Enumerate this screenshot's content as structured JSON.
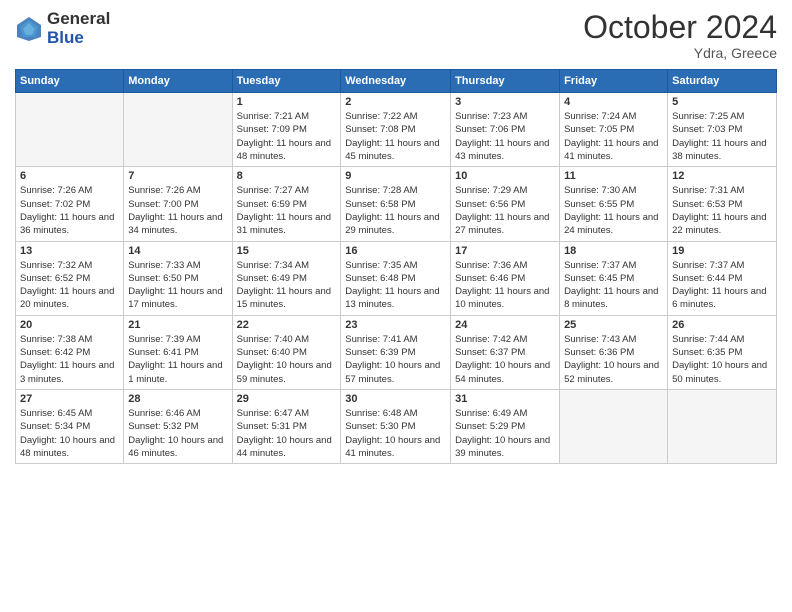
{
  "header": {
    "logo": {
      "general": "General",
      "blue": "Blue"
    },
    "title": "October 2024",
    "subtitle": "Ydra, Greece"
  },
  "weekdays": [
    "Sunday",
    "Monday",
    "Tuesday",
    "Wednesday",
    "Thursday",
    "Friday",
    "Saturday"
  ],
  "weeks": [
    [
      {
        "day": "",
        "info": ""
      },
      {
        "day": "",
        "info": ""
      },
      {
        "day": "1",
        "info": "Sunrise: 7:21 AM\nSunset: 7:09 PM\nDaylight: 11 hours and 48 minutes."
      },
      {
        "day": "2",
        "info": "Sunrise: 7:22 AM\nSunset: 7:08 PM\nDaylight: 11 hours and 45 minutes."
      },
      {
        "day": "3",
        "info": "Sunrise: 7:23 AM\nSunset: 7:06 PM\nDaylight: 11 hours and 43 minutes."
      },
      {
        "day": "4",
        "info": "Sunrise: 7:24 AM\nSunset: 7:05 PM\nDaylight: 11 hours and 41 minutes."
      },
      {
        "day": "5",
        "info": "Sunrise: 7:25 AM\nSunset: 7:03 PM\nDaylight: 11 hours and 38 minutes."
      }
    ],
    [
      {
        "day": "6",
        "info": "Sunrise: 7:26 AM\nSunset: 7:02 PM\nDaylight: 11 hours and 36 minutes."
      },
      {
        "day": "7",
        "info": "Sunrise: 7:26 AM\nSunset: 7:00 PM\nDaylight: 11 hours and 34 minutes."
      },
      {
        "day": "8",
        "info": "Sunrise: 7:27 AM\nSunset: 6:59 PM\nDaylight: 11 hours and 31 minutes."
      },
      {
        "day": "9",
        "info": "Sunrise: 7:28 AM\nSunset: 6:58 PM\nDaylight: 11 hours and 29 minutes."
      },
      {
        "day": "10",
        "info": "Sunrise: 7:29 AM\nSunset: 6:56 PM\nDaylight: 11 hours and 27 minutes."
      },
      {
        "day": "11",
        "info": "Sunrise: 7:30 AM\nSunset: 6:55 PM\nDaylight: 11 hours and 24 minutes."
      },
      {
        "day": "12",
        "info": "Sunrise: 7:31 AM\nSunset: 6:53 PM\nDaylight: 11 hours and 22 minutes."
      }
    ],
    [
      {
        "day": "13",
        "info": "Sunrise: 7:32 AM\nSunset: 6:52 PM\nDaylight: 11 hours and 20 minutes."
      },
      {
        "day": "14",
        "info": "Sunrise: 7:33 AM\nSunset: 6:50 PM\nDaylight: 11 hours and 17 minutes."
      },
      {
        "day": "15",
        "info": "Sunrise: 7:34 AM\nSunset: 6:49 PM\nDaylight: 11 hours and 15 minutes."
      },
      {
        "day": "16",
        "info": "Sunrise: 7:35 AM\nSunset: 6:48 PM\nDaylight: 11 hours and 13 minutes."
      },
      {
        "day": "17",
        "info": "Sunrise: 7:36 AM\nSunset: 6:46 PM\nDaylight: 11 hours and 10 minutes."
      },
      {
        "day": "18",
        "info": "Sunrise: 7:37 AM\nSunset: 6:45 PM\nDaylight: 11 hours and 8 minutes."
      },
      {
        "day": "19",
        "info": "Sunrise: 7:37 AM\nSunset: 6:44 PM\nDaylight: 11 hours and 6 minutes."
      }
    ],
    [
      {
        "day": "20",
        "info": "Sunrise: 7:38 AM\nSunset: 6:42 PM\nDaylight: 11 hours and 3 minutes."
      },
      {
        "day": "21",
        "info": "Sunrise: 7:39 AM\nSunset: 6:41 PM\nDaylight: 11 hours and 1 minute."
      },
      {
        "day": "22",
        "info": "Sunrise: 7:40 AM\nSunset: 6:40 PM\nDaylight: 10 hours and 59 minutes."
      },
      {
        "day": "23",
        "info": "Sunrise: 7:41 AM\nSunset: 6:39 PM\nDaylight: 10 hours and 57 minutes."
      },
      {
        "day": "24",
        "info": "Sunrise: 7:42 AM\nSunset: 6:37 PM\nDaylight: 10 hours and 54 minutes."
      },
      {
        "day": "25",
        "info": "Sunrise: 7:43 AM\nSunset: 6:36 PM\nDaylight: 10 hours and 52 minutes."
      },
      {
        "day": "26",
        "info": "Sunrise: 7:44 AM\nSunset: 6:35 PM\nDaylight: 10 hours and 50 minutes."
      }
    ],
    [
      {
        "day": "27",
        "info": "Sunrise: 6:45 AM\nSunset: 5:34 PM\nDaylight: 10 hours and 48 minutes."
      },
      {
        "day": "28",
        "info": "Sunrise: 6:46 AM\nSunset: 5:32 PM\nDaylight: 10 hours and 46 minutes."
      },
      {
        "day": "29",
        "info": "Sunrise: 6:47 AM\nSunset: 5:31 PM\nDaylight: 10 hours and 44 minutes."
      },
      {
        "day": "30",
        "info": "Sunrise: 6:48 AM\nSunset: 5:30 PM\nDaylight: 10 hours and 41 minutes."
      },
      {
        "day": "31",
        "info": "Sunrise: 6:49 AM\nSunset: 5:29 PM\nDaylight: 10 hours and 39 minutes."
      },
      {
        "day": "",
        "info": ""
      },
      {
        "day": "",
        "info": ""
      }
    ]
  ]
}
